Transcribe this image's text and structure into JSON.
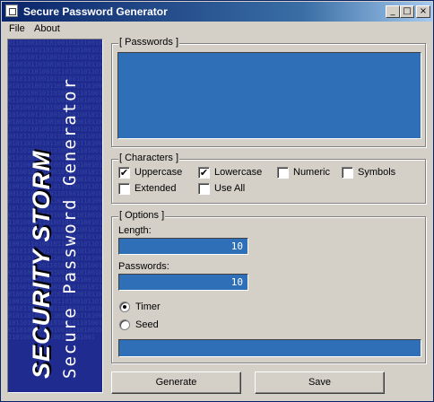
{
  "window": {
    "title": "Secure Password Generator"
  },
  "titlebar_buttons": {
    "minimize": "_",
    "maximize": "□",
    "close": "×"
  },
  "menu": {
    "file": "File",
    "about": "About"
  },
  "banner": {
    "brand": "SECURITY STORM",
    "subtitle": "Secure Password Generator"
  },
  "passwords": {
    "title": "[ Passwords ]",
    "value": ""
  },
  "characters": {
    "title": "[ Characters ]",
    "options": [
      {
        "label": "Uppercase",
        "checked": true
      },
      {
        "label": "Lowercase",
        "checked": true
      },
      {
        "label": "Numeric",
        "checked": false
      },
      {
        "label": "Symbols",
        "checked": false
      },
      {
        "label": "Extended",
        "checked": false
      },
      {
        "label": "Use All",
        "checked": false
      }
    ]
  },
  "options": {
    "title": "[ Options ]",
    "length_label": "Length:",
    "length_value": "10",
    "passwords_label": "Passwords:",
    "passwords_value": "10",
    "timer_label": "Timer",
    "seed_label": "Seed",
    "selected_source": "Timer",
    "seed_value": ""
  },
  "buttons": {
    "generate": "Generate",
    "save": "Save"
  },
  "colors": {
    "titlebar_start": "#0a246a",
    "titlebar_end": "#a6caf0",
    "field_blue": "#2f6fb8",
    "banner_blue": "#1f2b8f",
    "face": "#d4d0c8"
  },
  "icons": {
    "app": "app-icon",
    "checked": "checkmark-icon"
  }
}
